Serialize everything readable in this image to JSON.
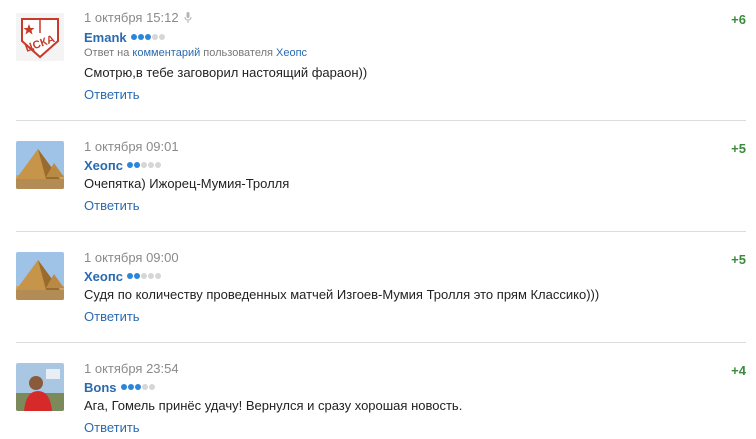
{
  "comments": [
    {
      "date": "1 октября 15:12",
      "author": "Emank",
      "rank_on": 3,
      "rating": "+6",
      "reply_prefix": "Ответ на",
      "reply_link": "комментарий",
      "reply_mid": "пользователя",
      "reply_user": "Хеопс",
      "text": "Смотрю,в тебе заговорил настоящий фараон))",
      "reply_label": "Ответить",
      "avatar": "cska-logo"
    },
    {
      "date": "1 октября 09:01",
      "author": "Хеопс",
      "rank_on": 2,
      "rating": "+5",
      "text": "Очепятка) Ижорец-Мумия-Тролля",
      "reply_label": "Ответить",
      "avatar": "pyramids"
    },
    {
      "date": "1 октября 09:00",
      "author": "Хеопс",
      "rank_on": 2,
      "rating": "+5",
      "text": "Судя по количеству проведенных матчей Изгоев-Мумия Тролля это прям Классико)))",
      "reply_label": "Ответить",
      "avatar": "pyramids"
    },
    {
      "date": "1 октября 23:54",
      "author": "Bons",
      "rank_on": 3,
      "rating": "+4",
      "text": "Ага, Гомель принёс удачу! Вернулся и сразу хорошая новость.",
      "reply_label": "Ответить",
      "avatar": "user-photo"
    }
  ],
  "colors": {
    "link": "#2a6ab0",
    "rating": "#3c8a3c",
    "date": "#8a8a8a",
    "dot_on": "#2a86d8",
    "dot_off": "#d6d6d6"
  }
}
